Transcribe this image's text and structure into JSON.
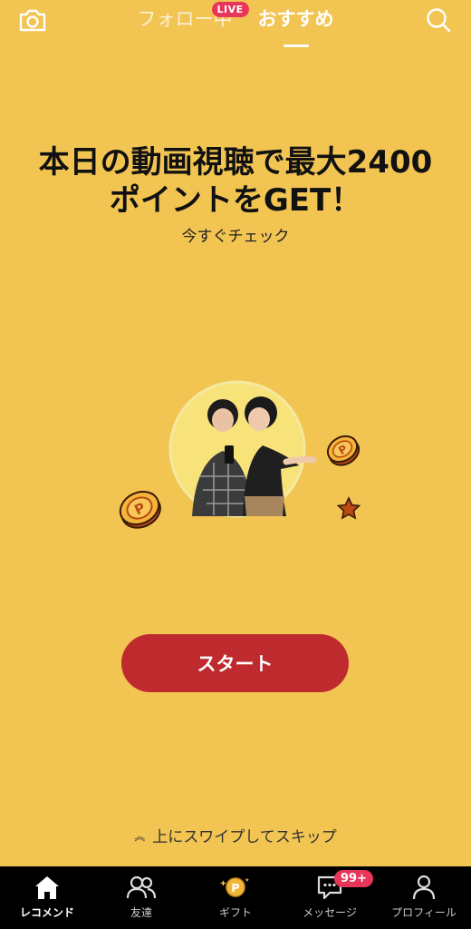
{
  "header": {
    "tabs": [
      {
        "label": "フォロー中",
        "active": false,
        "badge": "LIVE"
      },
      {
        "label": "おすすめ",
        "active": true
      }
    ],
    "left_icon": "camera-icon",
    "right_icon": "search-icon"
  },
  "promo": {
    "headline_line1": "本日の動画視聴で最大2400",
    "headline_line2": "ポイントをGET！",
    "subline": "今すぐチェック",
    "cta_label": "スタート",
    "swipe_hint": "上にスワイプしてスキップ"
  },
  "bottom_nav": {
    "items": [
      {
        "label": "レコメンド",
        "icon": "home-icon",
        "active": true
      },
      {
        "label": "友達",
        "icon": "friends-icon",
        "active": false
      },
      {
        "label": "ギフト",
        "icon": "gift-points-icon",
        "active": false
      },
      {
        "label": "メッセージ",
        "icon": "message-icon",
        "active": false,
        "badge": "99+"
      },
      {
        "label": "プロフィール",
        "icon": "profile-icon",
        "active": false
      }
    ]
  },
  "colors": {
    "background": "#f2c452",
    "cta": "#bf2a2e",
    "badge": "#e8365a",
    "nav_background": "#000000"
  }
}
